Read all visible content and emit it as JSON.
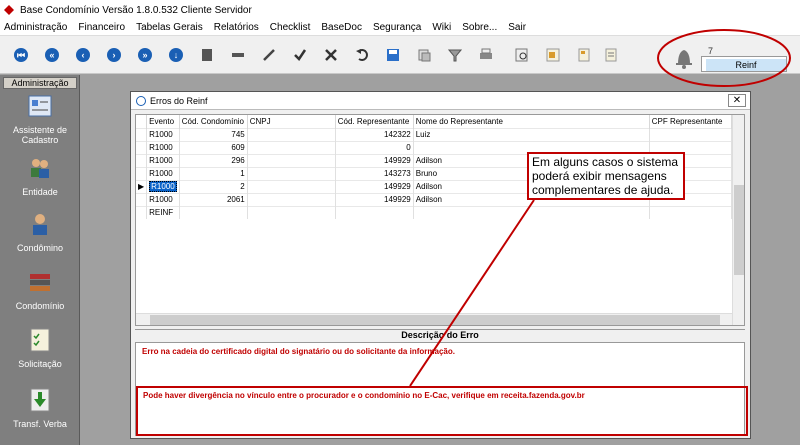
{
  "window": {
    "title": "Base Condomínio Versão 1.8.0.532 Cliente Servidor"
  },
  "menu": [
    "Administração",
    "Financeiro",
    "Tabelas Gerais",
    "Relatórios",
    "Checklist",
    "BaseDoc",
    "Segurança",
    "Wiki",
    "Sobre...",
    "Sair"
  ],
  "toolbar_icons": [
    "first-icon",
    "prev-page-icon",
    "prev-icon",
    "next-icon",
    "next-page-icon",
    "last-icon",
    "edit-icon",
    "delete-icon",
    "pencil-icon",
    "confirm-icon",
    "cancel-icon",
    "undo-icon",
    "save-icon",
    "copy-icon",
    "filter-icon",
    "print-icon",
    "preview-icon",
    "export-icon",
    "attach-icon",
    "notes-icon"
  ],
  "notifications": {
    "count": "7",
    "popup_item": "Reinf"
  },
  "sidebar": {
    "header": "Administração",
    "items": [
      {
        "label": "Assistente de Cadastro",
        "icon": "form-icon"
      },
      {
        "label": "Entidade",
        "icon": "people-icon"
      },
      {
        "label": "Condômino",
        "icon": "person-icon"
      },
      {
        "label": "Condomínio",
        "icon": "books-icon"
      },
      {
        "label": "Solicitação",
        "icon": "checklist-icon"
      },
      {
        "label": "Transf. Verba",
        "icon": "transfer-icon"
      }
    ]
  },
  "dialog": {
    "title": "Erros do Reinf",
    "columns": [
      "Evento",
      "Cód. Condomínio",
      "CNPJ",
      "Cód. Representante",
      "Nome do Representante",
      "CPF Representante"
    ],
    "rows": [
      {
        "evento": "R1000",
        "cod_condominio": "745",
        "cnpj": "",
        "cod_representante": "142322",
        "nome": "Luiz",
        "cpf": ""
      },
      {
        "evento": "R1000",
        "cod_condominio": "609",
        "cnpj": "",
        "cod_representante": "0",
        "nome": "",
        "cpf": ""
      },
      {
        "evento": "R1000",
        "cod_condominio": "296",
        "cnpj": "",
        "cod_representante": "149929",
        "nome": "Adilson",
        "cpf": ""
      },
      {
        "evento": "R1000",
        "cod_condominio": "1",
        "cnpj": "",
        "cod_representante": "143273",
        "nome": "Bruno",
        "cpf": ""
      },
      {
        "evento": "R1000",
        "cod_condominio": "2",
        "cnpj": "",
        "cod_representante": "149929",
        "nome": "Adilson",
        "cpf": ""
      },
      {
        "evento": "R1000",
        "cod_condominio": "2061",
        "cnpj": "",
        "cod_representante": "149929",
        "nome": "Adilson",
        "cpf": ""
      },
      {
        "evento": "REINF",
        "cod_condominio": "",
        "cnpj": "",
        "cod_representante": "",
        "nome": "",
        "cpf": ""
      }
    ],
    "selected_row": 4,
    "description_header": "Descrição do Erro",
    "error_message": "Erro na cadeia do certificado digital do signatário ou do solicitante da informação.",
    "help_message": "Pode haver divergência no vínculo entre o procurador e o condomínio no E-Cac, verifique em receita.fazenda.gov.br"
  },
  "callout": "Em alguns casos o sistema poderá exibir mensagens complementares de ajuda."
}
